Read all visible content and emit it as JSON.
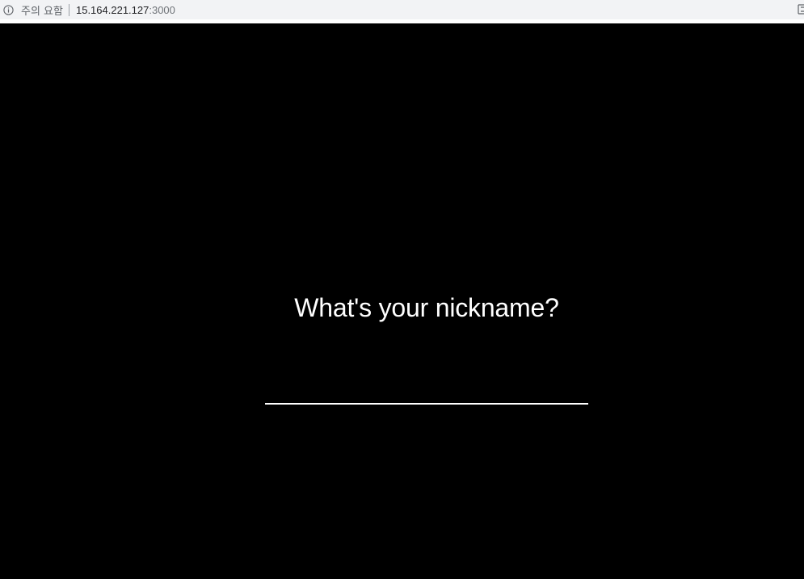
{
  "browser": {
    "security_label": "주의 요함",
    "url_host": "15.164.221.127",
    "url_port": ":3000"
  },
  "page": {
    "question": "What's your nickname?",
    "nickname_input": {
      "value": "",
      "placeholder": ""
    }
  },
  "icons": {
    "security": "info-circle-icon",
    "edge": "bookmark-edge-icon"
  },
  "colors": {
    "page_background": "#000000",
    "text": "#ffffff",
    "chrome_background": "#f2f3f5"
  }
}
